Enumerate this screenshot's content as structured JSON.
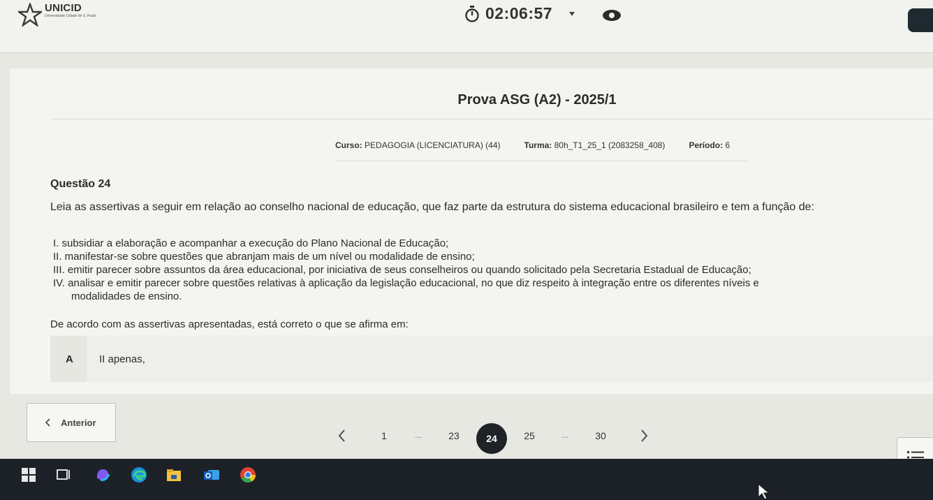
{
  "header": {
    "logo_name": "UNICID",
    "logo_sub": "Universidade Cidade de S. Paulo",
    "timer": "02:06:57"
  },
  "exam": {
    "title": "Prova ASG (A2) - 2025/1",
    "course_label": "Curso:",
    "course_value": "PEDAGOGIA (LICENCIATURA) (44)",
    "class_label": "Turma:",
    "class_value": "80h_T1_25_1 (2083258_408)",
    "period_label": "Período:",
    "period_value": "6"
  },
  "question": {
    "title": "Questão 24",
    "intro": "Leia as assertivas a seguir em relação ao  conselho nacional de educação, que faz parte da estrutura do sistema educacional brasileiro e tem a função de:",
    "assertions": [
      "I. subsidiar a elaboração e acompanhar a execução do Plano Nacional de Educação;",
      "II. manifestar-se sobre questões que abranjam mais de um nível ou modalidade de ensino;",
      "III. emitir parecer sobre assuntos da área educacional, por iniciativa de seus conselheiros ou quando solicitado pela Secretaria Estadual de Educação;",
      "IV. analisar e emitir parecer sobre questões relativas à aplicação da legislação educacional, no que diz respeito à integração entre os diferentes níveis e",
      "modalidades de ensino."
    ],
    "prompt": "De acordo com as assertivas apresentadas, está correto o que se afirma em:",
    "options": [
      {
        "letter": "A",
        "text": "II apenas,"
      }
    ]
  },
  "navigation": {
    "prev_label": "Anterior",
    "pages": [
      "1",
      "23",
      "24",
      "25",
      "30"
    ],
    "current_page": "24",
    "ellipsis": "..."
  }
}
